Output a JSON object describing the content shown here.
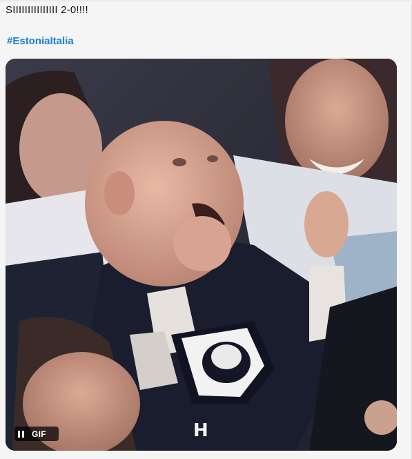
{
  "tweet": {
    "text": "SIIIIIIIIIIIIIII 2-0!!!!",
    "hashtag": "#EstoniaItalia"
  },
  "media": {
    "badge_label": "GIF",
    "seat_letter": "H"
  }
}
